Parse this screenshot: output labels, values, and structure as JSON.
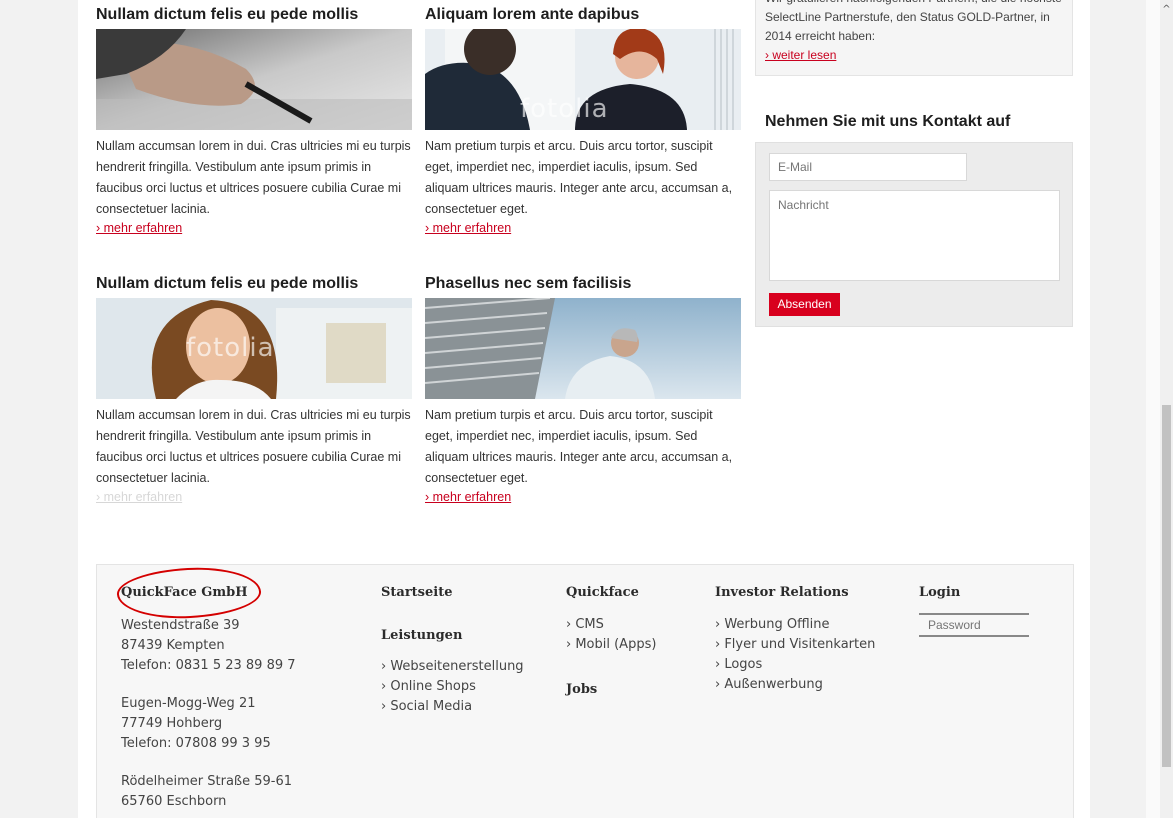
{
  "articles": [
    {
      "title": "Nullam dictum felis eu pede mollis",
      "text": "Nullam accumsan lorem in dui. Cras ultricies mi eu turpis hendrerit fringilla. Vestibulum ante ipsum primis in faucibus orci luctus et ultrices posuere cubilia Curae mi consectetuer lacinia.",
      "more": "› mehr erfahren"
    },
    {
      "title": "Aliquam lorem ante dapibus",
      "text": "Nam pretium turpis et arcu. Duis arcu tortor, suscipit eget, imperdiet nec, imperdiet iaculis, ipsum. Sed aliquam ultrices mauris. Integer ante arcu, accumsan a, consectetuer eget.",
      "more": "› mehr erfahren",
      "watermark": "fotolia"
    },
    {
      "title": "Nullam dictum felis eu pede mollis",
      "text": "Nullam accumsan lorem in dui. Cras ultricies mi eu turpis hendrerit fringilla. Vestibulum ante ipsum primis in faucibus orci luctus et ultrices posuere cubilia Curae mi consectetuer lacinia.",
      "more": "› mehr erfahren",
      "watermark": "fotolia"
    },
    {
      "title": "Phasellus nec sem facilisis",
      "text": "Nam pretium turpis et arcu. Duis arcu tortor, suscipit eget, imperdiet nec, imperdiet iaculis, ipsum. Sed aliquam ultrices mauris. Integer ante arcu, accumsan a, consectetuer eget.",
      "more": "› mehr erfahren"
    }
  ],
  "sidebar": {
    "partner_cut_line": "Wir gratulieren nachfolgenden Partnern, die die höchste",
    "partner_text": "SelectLine Partnerstufe, den Status GOLD-Partner, in 2014 erreicht haben:",
    "partner_link": "› weiter lesen",
    "contact_title": "Nehmen Sie mit uns Kontakt auf",
    "email_placeholder": "E-Mail",
    "message_placeholder": "Nachricht",
    "send_label": "Absenden"
  },
  "footer": {
    "company": "QuickFace GmbH",
    "addresses": [
      {
        "street": "Westendstraße 39",
        "city": "87439 Kempten",
        "phone": "Telefon: 0831 5 23 89 89 7"
      },
      {
        "street": "Eugen-Mogg-Weg 21",
        "city": "77749 Hohberg",
        "phone": "Telefon: 07808 99 3 95"
      },
      {
        "street": "Rödelheimer Straße 59-61",
        "city": "65760 Eschborn"
      }
    ],
    "col_start": {
      "title": "Startseite",
      "sub_title": "Leistungen",
      "items": [
        "› Webseitenerstellung",
        "› Online Shops",
        "› Social Media"
      ]
    },
    "col_quickface": {
      "title": "Quickface",
      "items": [
        "› CMS",
        "› Mobil (Apps)"
      ],
      "jobs": "Jobs"
    },
    "col_investor": {
      "title": "Investor Relations",
      "items": [
        "› Werbung Offline",
        "› Flyer und Visitenkarten",
        "› Logos",
        "› Außenwerbung"
      ]
    },
    "col_login": {
      "title": "Login",
      "password_placeholder": "Password"
    }
  },
  "colors": {
    "accent": "#d8001e",
    "annotation_circle": "#d40000"
  }
}
